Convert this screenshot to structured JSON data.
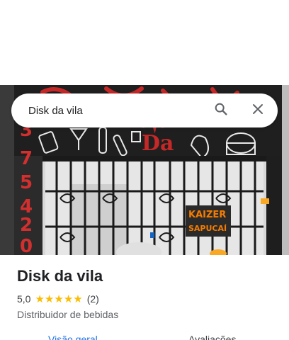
{
  "search": {
    "value": "Disk da vila",
    "search_icon": "search-icon",
    "close_icon": "close-icon"
  },
  "photo": {
    "sign_text": [
      "KAIZER",
      "SAPUCAÍ"
    ],
    "wall_text": "Disk da vila",
    "phone_digits": [
      "3",
      "7",
      "5",
      "4",
      "2",
      "0"
    ]
  },
  "place": {
    "title": "Disk da vila",
    "rating": "5,0",
    "stars": [
      "★",
      "★",
      "★",
      "★",
      "★"
    ],
    "review_count": "(2)",
    "category": "Distribuidor de bebidas"
  },
  "tabs": {
    "overview": "Visão geral",
    "reviews": "Avaliações"
  },
  "colors": {
    "accent": "#1a73e8",
    "star": "#fbbc04"
  }
}
